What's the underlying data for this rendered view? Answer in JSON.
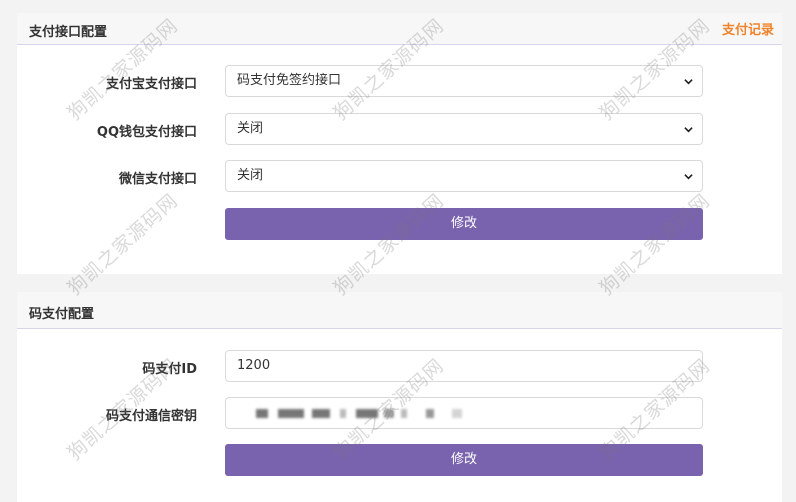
{
  "payment_panel": {
    "title": "支付接口配置",
    "records_link": "支付记录",
    "rows": [
      {
        "label": "支付宝支付接口",
        "value": "码支付免签约接口"
      },
      {
        "label": "QQ钱包支付接口",
        "value": "关闭"
      },
      {
        "label": "微信支付接口",
        "value": "关闭"
      }
    ],
    "submit_label": "修改"
  },
  "codepay_panel": {
    "title": "码支付配置",
    "id_label": "码支付ID",
    "id_value": "1200",
    "key_label": "码支付通信密钥",
    "submit_label": "修改"
  },
  "watermark": "狗凯之家源码网",
  "colors": {
    "accent": "#7a63ae",
    "link": "#f0842c"
  }
}
